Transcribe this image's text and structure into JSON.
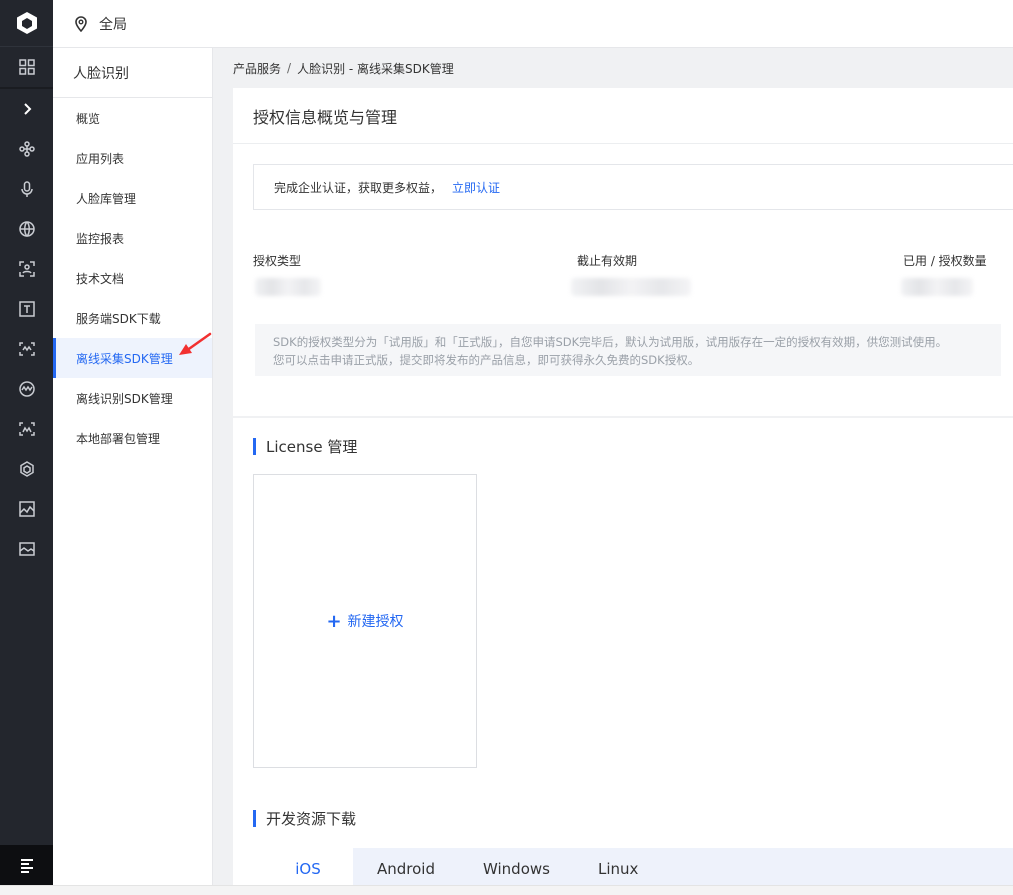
{
  "header": {
    "location_icon": "location-pin-icon",
    "scope_label": "全局"
  },
  "rail": {
    "icons": [
      "grid-icon",
      "chevron-right-icon",
      "nodes-icon",
      "microphone-icon",
      "globe-icon",
      "scan-icon",
      "text-box-icon",
      "face-scan-icon",
      "vr-icon",
      "body-scan-icon",
      "cube-icon",
      "image-icon",
      "landscape-icon"
    ],
    "bottom_icon": "menu-icon"
  },
  "subnav": {
    "title": "人脸识别",
    "items": [
      {
        "label": "概览"
      },
      {
        "label": "应用列表"
      },
      {
        "label": "人脸库管理"
      },
      {
        "label": "监控报表"
      },
      {
        "label": "技术文档"
      },
      {
        "label": "服务端SDK下载"
      },
      {
        "label": "离线采集SDK管理"
      },
      {
        "label": "离线识别SDK管理"
      },
      {
        "label": "本地部署包管理"
      }
    ],
    "active_index": 6
  },
  "breadcrumb": {
    "root": "产品服务",
    "separator": "/",
    "current": "人脸识别 - 离线采集SDK管理"
  },
  "overview": {
    "title": "授权信息概览与管理",
    "notice_text": "完成企业认证，获取更多权益，",
    "notice_link": "立即认证",
    "stats": [
      {
        "label": "授权类型"
      },
      {
        "label": "截止有效期"
      },
      {
        "label": "已用 / 授权数量"
      }
    ],
    "hint_line1": "SDK的授权类型分为「试用版」和「正式版」，自您申请SDK完毕后，默认为试用版，试用版存在一定的授权有效期，供您测试使用。",
    "hint_line2": "您可以点击申请正式版，提交即将发布的产品信息，即可获得永久免费的SDK授权。"
  },
  "license": {
    "title": "License 管理",
    "new_label": "新建授权"
  },
  "downloads": {
    "title": "开发资源下载",
    "tabs": [
      {
        "label": "iOS"
      },
      {
        "label": "Android"
      },
      {
        "label": "Windows"
      },
      {
        "label": "Linux"
      }
    ],
    "active_tab": 0
  },
  "colors": {
    "accent": "#2468f2",
    "rail_bg": "#23262d",
    "annotation": "#f23030"
  }
}
